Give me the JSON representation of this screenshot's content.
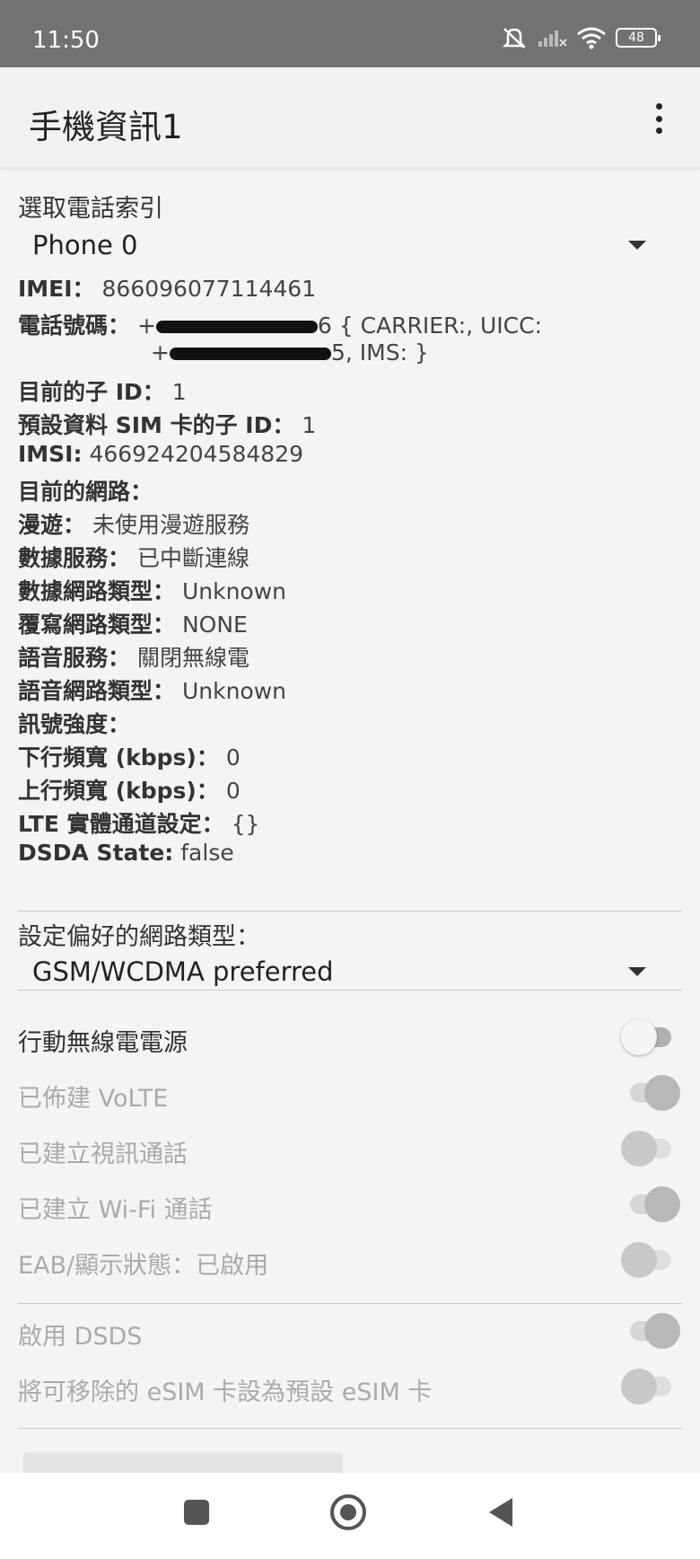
{
  "status_bar": {
    "time": "11:50",
    "battery": "48",
    "icons": [
      "mute-icon",
      "signal-icon",
      "wifi-icon",
      "battery-icon"
    ]
  },
  "app_bar": {
    "title": "手機資訊1",
    "menu_icon": "more-vert-icon"
  },
  "phone_index": {
    "label": "選取電話索引",
    "selected": "Phone 0"
  },
  "info": {
    "imei_label": "IMEI：",
    "imei_value": "866096077114461",
    "phone_label": "電話號碼：",
    "phone_line1_start": "+",
    "phone_line1_tail": "6 { CARRIER:, UICC:",
    "phone_line2_start": "+",
    "phone_line2_tail": "5, IMS: }",
    "subid_label": "目前的子 ID：",
    "subid_value": "1",
    "default_sim_label": "預設資料 SIM 卡的子 ID：",
    "default_sim_value": "1",
    "imsi_label": "IMSI:",
    "imsi_value": "466924204584829",
    "network_label": "目前的網路：",
    "network_value": "",
    "roaming_label": "漫遊：",
    "roaming_value": "未使用漫遊服務",
    "data_service_label": "數據服務：",
    "data_service_value": "已中斷連線",
    "data_net_type_label": "數據網路類型：",
    "data_net_type_value": "Unknown",
    "override_net_type_label": "覆寫網路類型：",
    "override_net_type_value": "NONE",
    "voice_service_label": "語音服務：",
    "voice_service_value": "關閉無線電",
    "voice_net_type_label": "語音網路類型：",
    "voice_net_type_value": "Unknown",
    "signal_label": "訊號強度：",
    "signal_value": "",
    "dl_bw_label": "下行頻寬 (kbps)：",
    "dl_bw_value": "0",
    "ul_bw_label": "上行頻寬 (kbps)：",
    "ul_bw_value": "0",
    "lte_label": "LTE 實體通道設定：",
    "lte_value": "{}",
    "dsda_label": "DSDA State:",
    "dsda_value": "false"
  },
  "preferred_network": {
    "label": "設定偏好的網路類型：",
    "selected": "GSM/WCDMA preferred"
  },
  "switches": [
    {
      "label": "行動無線電電源",
      "on": false,
      "enabled": true
    },
    {
      "label": "已佈建 VoLTE",
      "on": true,
      "enabled": false
    },
    {
      "label": "已建立視訊通話",
      "on": false,
      "enabled": false
    },
    {
      "label": "已建立 Wi-Fi 通話",
      "on": true,
      "enabled": false
    },
    {
      "label": "EAB/顯示狀態：已啟用",
      "on": false,
      "enabled": false
    },
    {
      "label": "啟用 DSDS",
      "on": true,
      "enabled": false
    },
    {
      "label": "將可移除的 eSIM 卡設為預設 eSIM 卡",
      "on": false,
      "enabled": false
    }
  ],
  "nav_bar": {
    "icons": [
      "recents-icon",
      "home-icon",
      "back-icon"
    ]
  }
}
